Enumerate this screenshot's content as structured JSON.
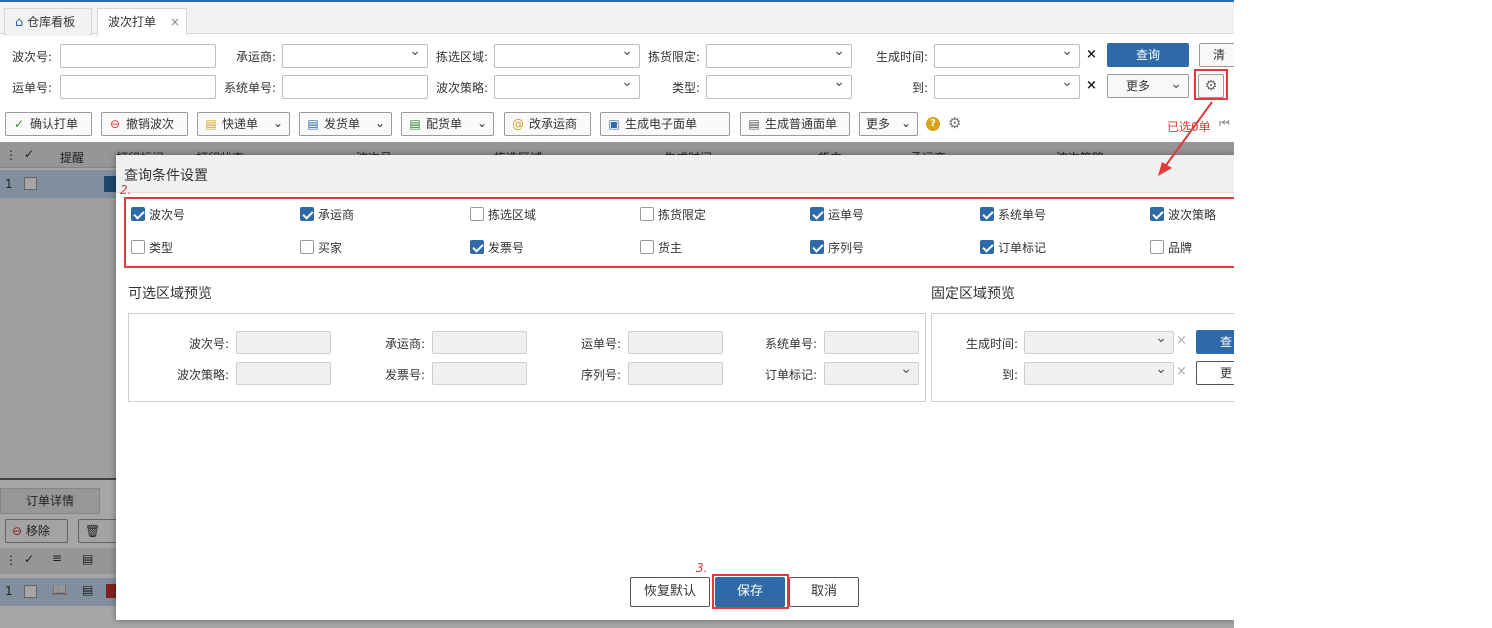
{
  "tabs": [
    {
      "label": "仓库看板",
      "icon": "home-icon"
    },
    {
      "label": "波次打单",
      "close": "×"
    }
  ],
  "filters": {
    "wave_no": "波次号:",
    "carrier": "承运商:",
    "pick_area": "拣选区域:",
    "pick_limit": "拣货限定:",
    "gen_time": "生成时间:",
    "waybill_no": "运单号:",
    "system_no": "系统单号:",
    "wave_strategy": "波次策略:",
    "type": "类型:",
    "to": "到:",
    "query_btn": "查询",
    "more_btn": "更多",
    "clear_btn": "清"
  },
  "toolbar": {
    "confirm_print": "确认打单",
    "cancel_wave": "撤销波次",
    "express": "快递单",
    "ship": "发货单",
    "picking": "配货单",
    "change_carrier": "改承运商",
    "gen_e_waybill": "生成电子面单",
    "gen_normal": "生成普通面单",
    "more": "更多",
    "selected": "已选0单"
  },
  "grid": {
    "headers": [
      "提醒",
      "打印标记",
      "打印状态",
      "波次号",
      "拣选区域",
      "生成时间",
      "货主",
      "承运商",
      "波次策略"
    ],
    "row_index": "1"
  },
  "lower": {
    "tab": "订单详情",
    "remove": "移除",
    "row_index": "1"
  },
  "modal": {
    "title": "查询条件设置",
    "options": [
      {
        "label": "波次号",
        "checked": true
      },
      {
        "label": "承运商",
        "checked": true
      },
      {
        "label": "拣选区域",
        "checked": false
      },
      {
        "label": "拣货限定",
        "checked": false
      },
      {
        "label": "运单号",
        "checked": true
      },
      {
        "label": "系统单号",
        "checked": true
      },
      {
        "label": "波次策略",
        "checked": true
      },
      {
        "label": "类型",
        "checked": false
      },
      {
        "label": "买家",
        "checked": false
      },
      {
        "label": "发票号",
        "checked": true
      },
      {
        "label": "货主",
        "checked": false
      },
      {
        "label": "序列号",
        "checked": true
      },
      {
        "label": "订单标记",
        "checked": true
      },
      {
        "label": "品牌",
        "checked": false
      }
    ],
    "optional_title": "可选区域预览",
    "fixed_title": "固定区域预览",
    "preview_fields": [
      "波次号:",
      "承运商:",
      "运单号:",
      "系统单号:",
      "波次策略:",
      "发票号:",
      "序列号:",
      "订单标记:"
    ],
    "fixed_fields": [
      "生成时间:",
      "到:"
    ],
    "fixed_query": "查",
    "fixed_more": "更",
    "restore_btn": "恢复默认",
    "save_btn": "保存",
    "cancel_btn": "取消"
  },
  "annotations": {
    "step2": "2.",
    "step3": "3."
  },
  "colors": {
    "primary": "#2f6aa8",
    "annotation_red": "#e03a3a",
    "grid_selected": "#c5dbf1"
  }
}
